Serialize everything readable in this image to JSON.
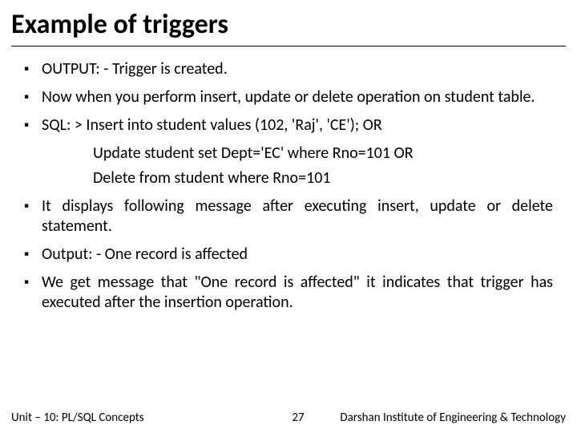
{
  "title": "Example of triggers",
  "bullets": {
    "b1": "OUTPUT: - Trigger is created.",
    "b2": "Now when you perform insert, update or delete operation on student table.",
    "b3": "SQL: >   Insert into student values (102, 'Raj', 'CE'); OR",
    "b3_sub1": "Update student set Dept='EC' where Rno=101 OR",
    "b3_sub2": "Delete from student where Rno=101",
    "b4": "It displays following message after executing insert, update or delete statement.",
    "b5": "Output: - One record is affected",
    "b6": "We get message that \"One record is affected\" it indicates that trigger has executed after the insertion operation."
  },
  "footer": {
    "unit": "Unit – 10: PL/SQL Concepts",
    "page": "27",
    "institute": "Darshan Institute of Engineering & Technology"
  }
}
